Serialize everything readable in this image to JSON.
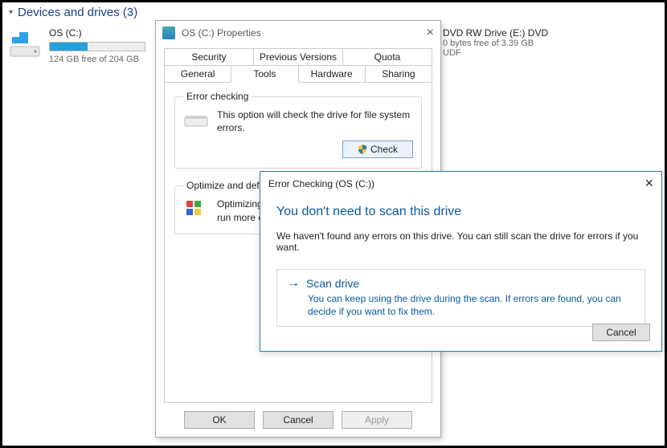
{
  "explorer": {
    "group_label": "Devices and drives (3)",
    "driveC": {
      "title": "OS (C:)",
      "free": "124 GB free of 204 GB",
      "fill_pct": 40
    },
    "dvd": {
      "title": "DVD RW Drive (E:) DVD",
      "free": "0 bytes free of 3.39 GB",
      "fs": "UDF"
    }
  },
  "properties": {
    "title": "OS (C:) Properties",
    "tabs_top": [
      "Security",
      "Previous Versions",
      "Quota"
    ],
    "tabs_bottom": [
      "General",
      "Tools",
      "Hardware",
      "Sharing"
    ],
    "active_tab": "Tools",
    "error_checking": {
      "legend": "Error checking",
      "text": "This option will check the drive for file system errors.",
      "button": "Check"
    },
    "optimize": {
      "legend": "Optimize and defragment drive",
      "text": "Optimizing your computer's drives can help it run more efficiently."
    },
    "buttons": {
      "ok": "OK",
      "cancel": "Cancel",
      "apply": "Apply"
    }
  },
  "error_dialog": {
    "title": "Error Checking (OS (C:))",
    "heading": "You don't need to scan this drive",
    "message": "We haven't found any errors on this drive. You can still scan the drive for errors if you want.",
    "scan_title": "Scan drive",
    "scan_desc": "You can keep using the drive during the scan. If errors are found, you can decide if you want to fix them.",
    "cancel": "Cancel"
  }
}
